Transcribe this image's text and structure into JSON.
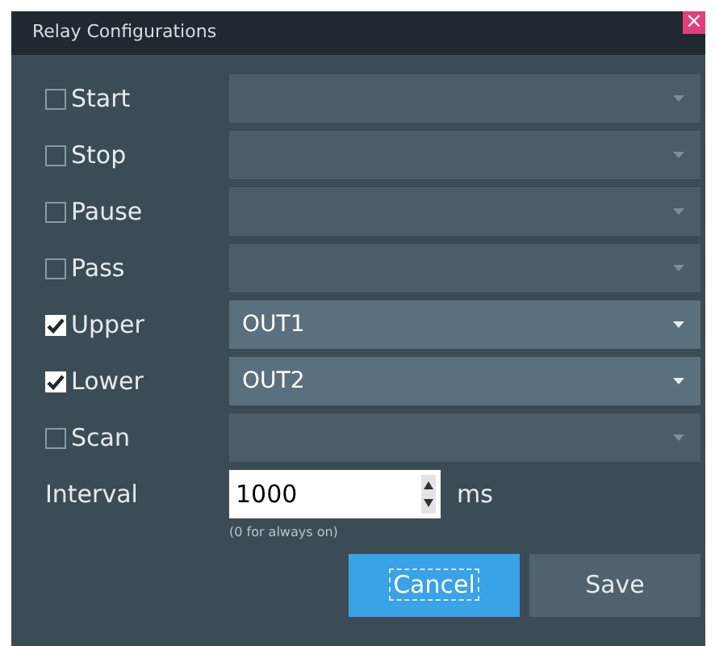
{
  "window": {
    "title": "Relay Configurations",
    "close": "×"
  },
  "relays": [
    {
      "label": "Start",
      "checked": false
    },
    {
      "label": "Stop",
      "checked": false
    },
    {
      "label": "Pause",
      "checked": false
    },
    {
      "label": "Pass",
      "checked": false
    },
    {
      "label": "Upper",
      "checked": true,
      "value": "OUT1"
    },
    {
      "label": "Lower",
      "checked": true,
      "value": "OUT2"
    },
    {
      "label": "Scan",
      "checked": false
    }
  ],
  "interval": {
    "label": "Interval",
    "value": "1000",
    "unit": "ms",
    "hint": "(0 for always on)"
  },
  "buttons": [
    {
      "label": "Cancel",
      "selected": true
    },
    {
      "label": "Save",
      "selected": false
    }
  ]
}
